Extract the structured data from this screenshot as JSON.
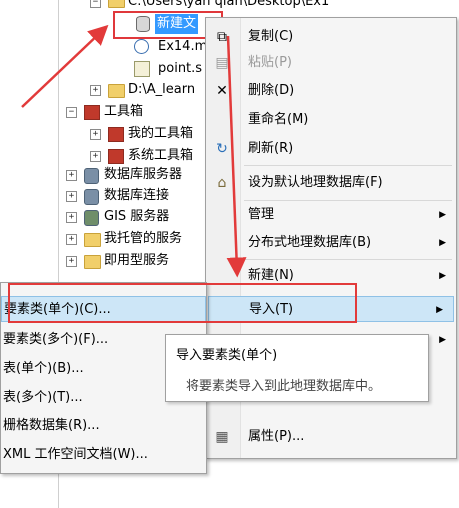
{
  "tree": {
    "nodes": [
      {
        "label": "C:\\Users\\yan qian\\Desktop\\Ex1",
        "icon": "folder-icon"
      },
      {
        "label": "新建文",
        "icon": "geodatabase-icon"
      },
      {
        "label": "Ex14.m",
        "icon": "map-document-icon"
      },
      {
        "label": "point.s",
        "icon": "shapefile-icon"
      },
      {
        "label": "D:\\A_learn",
        "icon": "folder-icon"
      },
      {
        "label": "工具箱",
        "icon": "toolbox-icon"
      },
      {
        "label": "我的工具箱",
        "icon": "toolbox-icon"
      },
      {
        "label": "系统工具箱",
        "icon": "toolbox-icon"
      },
      {
        "label": "数据库服务器",
        "icon": "database-server-icon"
      },
      {
        "label": "数据库连接",
        "icon": "database-connection-icon"
      },
      {
        "label": "GIS 服务器",
        "icon": "gis-server-icon"
      },
      {
        "label": "我托管的服务",
        "icon": "hosted-services-icon"
      },
      {
        "label": "即用型服务",
        "icon": "ready-services-icon"
      }
    ]
  },
  "context_menu": {
    "items": [
      {
        "label": "复制(C)",
        "icon": "copy-icon",
        "enabled": true
      },
      {
        "label": "粘贴(P)",
        "icon": "paste-icon",
        "enabled": false
      },
      {
        "label": "删除(D)",
        "icon": "delete-icon",
        "enabled": true
      },
      {
        "label": "重命名(M)",
        "icon": "",
        "enabled": true
      },
      {
        "label": "刷新(R)",
        "icon": "refresh-icon",
        "enabled": true
      },
      {
        "label": "设为默认地理数据库(F)",
        "icon": "default-gdb-icon",
        "enabled": true
      },
      {
        "label": "管理",
        "icon": "",
        "enabled": true,
        "submenu": true
      },
      {
        "label": "分布式地理数据库(B)",
        "icon": "",
        "enabled": true,
        "submenu": true
      },
      {
        "label": "新建(N)",
        "icon": "",
        "enabled": true,
        "submenu": true
      },
      {
        "label": "导入(T)",
        "icon": "",
        "enabled": true,
        "submenu": true,
        "highlighted": true
      },
      {
        "label": "属性(P)...",
        "icon": "properties-icon",
        "enabled": true
      }
    ]
  },
  "import_submenu": {
    "items": [
      {
        "label": "要素类(单个)(C)...",
        "highlighted": true
      },
      {
        "label": "要素类(多个)(F)..."
      },
      {
        "label": "表(单个)(B)..."
      },
      {
        "label": "表(多个)(T)..."
      },
      {
        "label": "栅格数据集(R)..."
      },
      {
        "label": "XML 工作空间文档(W)..."
      }
    ]
  },
  "tooltip": {
    "title": "导入要素类(单个)",
    "description": "将要素类导入到此地理数据库中。"
  },
  "colors": {
    "annotation_red": "#e23a3a",
    "selection_blue": "#3399ff",
    "menu_hover": "#cde6f7"
  }
}
